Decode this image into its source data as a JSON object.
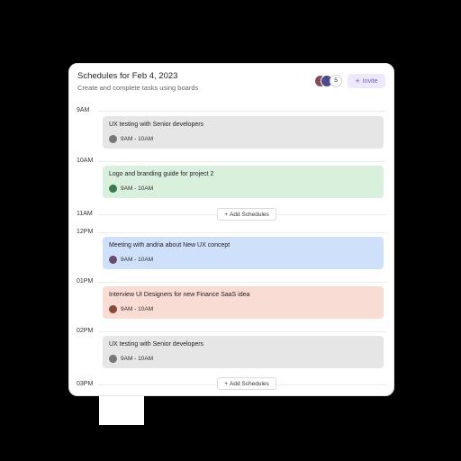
{
  "header": {
    "title": "Schedules for Feb 4, 2023",
    "subtitle": "Create and complete tasks using boards",
    "avatar_count": "5",
    "invite_label": "Invite"
  },
  "times": [
    "9AM",
    "10AM",
    "11AM",
    "12PM",
    "01PM",
    "02PM",
    "03PM"
  ],
  "events": [
    {
      "title": "UX testing with Senior developers",
      "time": "9AM - 10AM",
      "color": "#e6e6e6"
    },
    {
      "title": "Logo and branding guide for project 2",
      "time": "9AM - 10AM",
      "color": "#d8f0dc"
    },
    {
      "title": "Meeting with andria about New UX concept",
      "time": "9AM - 10AM",
      "color": "#cfe0fa"
    },
    {
      "title": "Interview UI Designers for new Finance SaaS idea",
      "time": "9AM - 10AM",
      "color": "#f9dcd4"
    },
    {
      "title": "UX testing with Senior developers",
      "time": "9AM - 10AM",
      "color": "#e6e6e6"
    }
  ],
  "add_schedules_label": "Add Schedules"
}
